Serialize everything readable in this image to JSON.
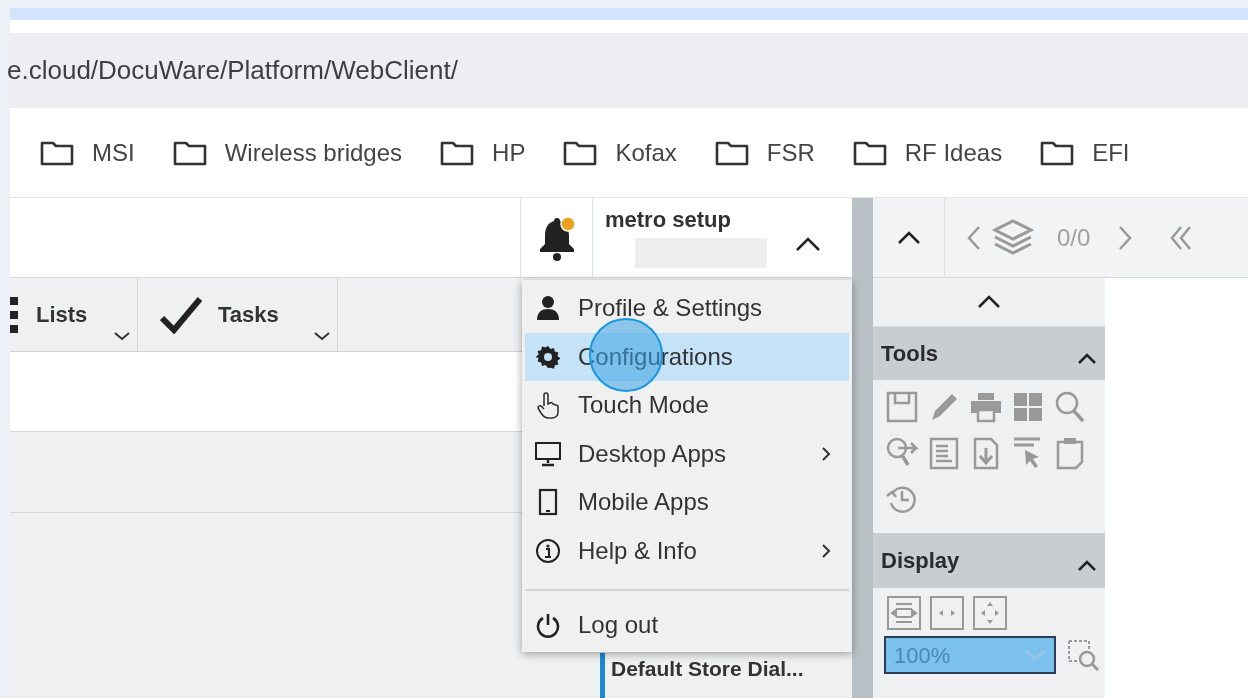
{
  "browser": {
    "url": "e.cloud/DocuWare/Platform/WebClient/",
    "bookmarks": [
      {
        "label": "MSI"
      },
      {
        "label": "Wireless bridges"
      },
      {
        "label": "HP"
      },
      {
        "label": "Kofax"
      },
      {
        "label": "FSR"
      },
      {
        "label": "RF Ideas"
      },
      {
        "label": "EFI"
      }
    ]
  },
  "header": {
    "user_name": "metro setup",
    "notification_unread": true
  },
  "tabs": [
    {
      "label": "Lists",
      "kind": "lists"
    },
    {
      "label": "Tasks",
      "kind": "tasks"
    }
  ],
  "background_item": {
    "title": "Default Store Dial..."
  },
  "user_menu": {
    "items": [
      {
        "label": "Profile & Settings",
        "kind": "person",
        "submenu": false,
        "selected": false
      },
      {
        "label": "Configurations",
        "kind": "gear",
        "submenu": false,
        "selected": true
      },
      {
        "label": "Touch Mode",
        "kind": "touch",
        "submenu": false,
        "selected": false
      },
      {
        "label": "Desktop Apps",
        "kind": "monitor",
        "submenu": true,
        "selected": false
      },
      {
        "label": "Mobile Apps",
        "kind": "tablet",
        "submenu": false,
        "selected": false
      },
      {
        "label": "Help & Info",
        "kind": "info",
        "submenu": true,
        "selected": false
      }
    ],
    "logout": "Log out"
  },
  "viewer": {
    "page_counter": "0/0",
    "tools_title": "Tools",
    "display_title": "Display",
    "zoom": "100%"
  }
}
